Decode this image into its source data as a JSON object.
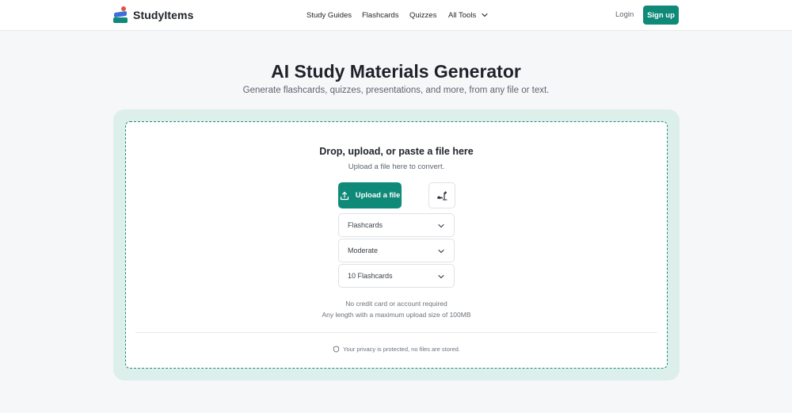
{
  "header": {
    "brand": "StudyItems",
    "nav": [
      {
        "label": "Study Guides"
      },
      {
        "label": "Flashcards"
      },
      {
        "label": "Quizzes"
      },
      {
        "label": "All Tools"
      }
    ],
    "login": "Login",
    "signup": "Sign up"
  },
  "hero": {
    "title": "AI Study Materials Generator",
    "subtitle": "Generate flashcards, quizzes, presentations, and more, from any file or text."
  },
  "uploader": {
    "title": "Drop, upload, or paste a file here",
    "subtitle": "Upload a file here to convert.",
    "upload_label": "Upload a file",
    "selects": [
      {
        "value": "Flashcards"
      },
      {
        "value": "Moderate"
      },
      {
        "value": "10 Flashcards"
      }
    ],
    "note1": "No credit card or account required",
    "note2": "Any length with a maximum upload size of 100MB",
    "privacy": "Your privacy is protected, no files are stored."
  },
  "colors": {
    "accent": "#0f8a78",
    "card_bg": "#dcefeb",
    "page_bg": "#f6f7f9"
  },
  "icons": [
    "logo-icon",
    "chevron-down-icon",
    "upload-icon",
    "signature-icon",
    "shield-icon"
  ]
}
